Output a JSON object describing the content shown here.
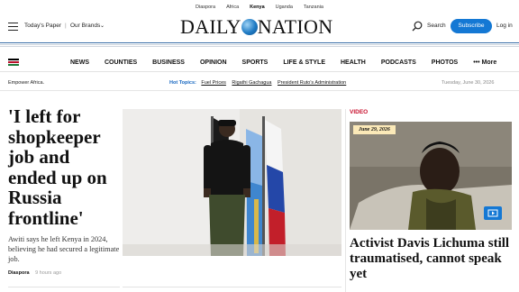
{
  "editions": {
    "items": [
      "Diaspora",
      "Africa",
      "Kenya",
      "Uganda",
      "Tanzania"
    ],
    "active": "Kenya"
  },
  "masthead": {
    "todays_paper": "Today's Paper",
    "separator": "|",
    "our_brands": "Our Brands",
    "logo_left": "DAILY",
    "logo_right": "NATION",
    "search_label": "Search",
    "subscribe_label": "Subscribe",
    "login_label": "Log in"
  },
  "nav": {
    "items": [
      "NEWS",
      "COUNTIES",
      "BUSINESS",
      "OPINION",
      "SPORTS",
      "LIFE & STYLE",
      "HEALTH",
      "PODCASTS",
      "PHOTOS"
    ],
    "more_label": "••• More"
  },
  "topics": {
    "empower": "Empower Africa.",
    "hot_label": "Hot Topics:",
    "items": [
      "Fuel Prices",
      "Rigathi Gachagua",
      "President Ruto's Administration"
    ],
    "date": "Tuesday, June 30, 2026"
  },
  "lead": {
    "title": "'I left for shopkeeper job and ended up on Russia frontline'",
    "summary": "Awiti says he left Kenya in 2024, believing he had secured a legitimate job.",
    "section": "Diaspora",
    "age": "9 hours ago"
  },
  "video": {
    "label": "VIDEO",
    "date_badge": "June 29, 2026",
    "title": "Activist Davis Lichuma still traumatised, cannot speak yet"
  },
  "colors": {
    "accent_blue": "#1478d4",
    "video_red": "#c8102e",
    "hot_topics_blue": "#1566c0"
  },
  "icons": [
    "menu-icon",
    "chevron-down-icon",
    "globe-icon",
    "search-icon",
    "kenya-flag-icon",
    "play-icon"
  ]
}
